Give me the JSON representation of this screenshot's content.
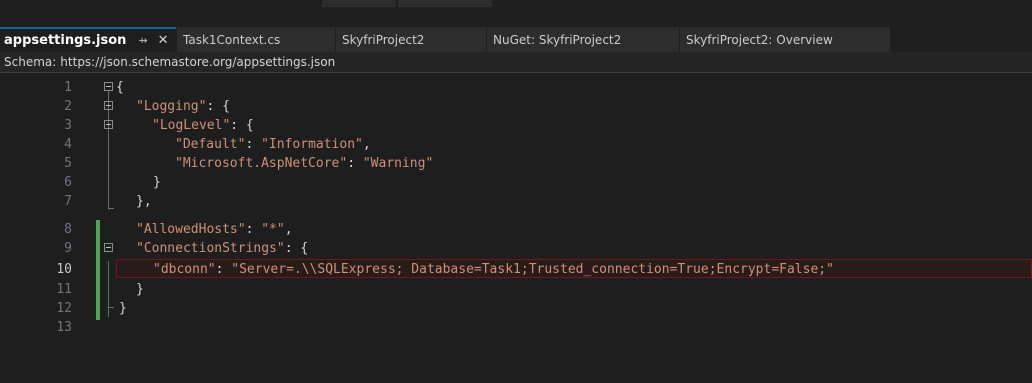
{
  "tabs": [
    {
      "label": "appsettings.json",
      "active": true
    },
    {
      "label": "Task1Context.cs",
      "active": false
    },
    {
      "label": "SkyfriProject2",
      "active": false
    },
    {
      "label": "NuGet: SkyfriProject2",
      "active": false
    },
    {
      "label": "SkyfriProject2: Overview",
      "active": false
    }
  ],
  "tab_icons": {
    "pin": "pin-icon",
    "close": "close-icon"
  },
  "schema": {
    "label": "Schema:",
    "url": "https://json.schemastore.org/appsettings.json"
  },
  "editor": {
    "current_line": 10,
    "line_numbers": [
      "1",
      "2",
      "3",
      "4",
      "5",
      "6",
      "7",
      "8",
      "9",
      "10",
      "11",
      "12",
      "13"
    ]
  },
  "code": {
    "l1_open": "{",
    "l2_key": "\"Logging\"",
    "l2_rest": ": {",
    "l3_key": "\"LogLevel\"",
    "l3_rest": ": {",
    "l4_key": "\"Default\"",
    "l4_colon": ": ",
    "l4_val": "\"Information\"",
    "l4_comma": ",",
    "l5_key": "\"Microsoft.AspNetCore\"",
    "l5_colon": ": ",
    "l5_val": "\"Warning\"",
    "l6_close": "}",
    "l7_close": "},",
    "l8_key": "\"AllowedHosts\"",
    "l8_colon": ": ",
    "l8_val": "\"*\"",
    "l8_comma": ",",
    "l9_key": "\"ConnectionStrings\"",
    "l9_rest": ": {",
    "l10_key": "\"dbconn\"",
    "l10_colon": ": ",
    "l10_val": "\"Server=.\\\\SQLExpress; Database=Task1;Trusted_connection=True;Encrypt=False;\"",
    "l11_close": "}",
    "l12_close": "}"
  },
  "colors": {
    "accent": "#0e639c",
    "string": "#ce9178",
    "change_bar": "#4ea34e",
    "background": "#1e1e1e"
  }
}
